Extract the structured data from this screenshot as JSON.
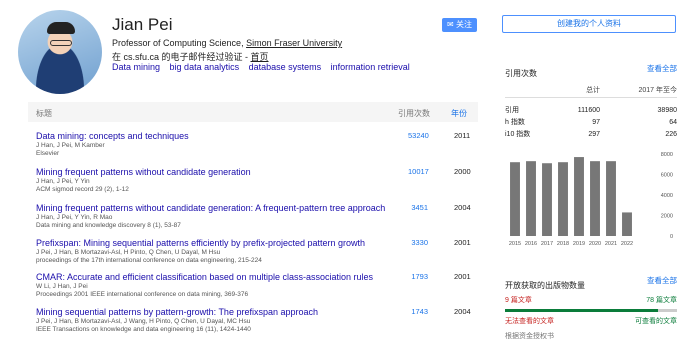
{
  "profile": {
    "name": "Jian Pei",
    "affil_prefix": "Professor of Computing Science, ",
    "affil_org": "Simon Fraser University",
    "verified_prefix": "在 cs.sfu.ca 的电子邮件经过验证 - ",
    "verified_link": "首页",
    "tags": [
      "Data mining",
      "big data analytics",
      "database systems",
      "information retrieval"
    ]
  },
  "buttons": {
    "follow": "关注",
    "create_profile": "创建我的个人资料"
  },
  "table": {
    "col_title": "标题",
    "col_cited": "引用次数",
    "col_year": "年份"
  },
  "articles": [
    {
      "title": "Data mining: concepts and techniques",
      "authors": "J Han, J Pei, M Kamber",
      "venue": "Elsevier",
      "cited": "53240",
      "year": "2011"
    },
    {
      "title": "Mining frequent patterns without candidate generation",
      "authors": "J Han, J Pei, Y Yin",
      "venue": "ACM sigmod record 29 (2), 1-12",
      "cited": "10017",
      "year": "2000"
    },
    {
      "title": "Mining frequent patterns without candidate generation: A frequent-pattern tree approach",
      "authors": "J Han, J Pei, Y Yin, R Mao",
      "venue": "Data mining and knowledge discovery 8 (1), 53-87",
      "cited": "3451",
      "year": "2004"
    },
    {
      "title": "Prefixspan: Mining sequential patterns efficiently by prefix-projected pattern growth",
      "authors": "J Pei, J Han, B Mortazavi-Asl, H Pinto, Q Chen, U Dayal, M Hsu",
      "venue": "proceedings of the 17th international conference on data engineering, 215-224",
      "cited": "3330",
      "year": "2001"
    },
    {
      "title": "CMAR: Accurate and efficient classification based on multiple class-association rules",
      "authors": "W Li, J Han, J Pei",
      "venue": "Proceedings 2001 IEEE international conference on data mining, 369-376",
      "cited": "1793",
      "year": "2001"
    },
    {
      "title": "Mining sequential patterns by pattern-growth: The prefixspan approach",
      "authors": "J Pei, J Han, B Mortazavi-Asl, J Wang, H Pinto, Q Chen, U Dayal, MC Hsu",
      "venue": "IEEE Transactions on knowledge and data engineering 16 (11), 1424-1440",
      "cited": "1743",
      "year": "2004"
    }
  ],
  "citations": {
    "title": "引用次数",
    "view_all": "查看全部",
    "col_all": "总计",
    "col_since": "2017 年至今",
    "rows": [
      {
        "label": "引用",
        "all": "111600",
        "since": "38980"
      },
      {
        "label": "h 指数",
        "all": "97",
        "since": "64"
      },
      {
        "label": "i10 指数",
        "all": "297",
        "since": "226"
      }
    ]
  },
  "chart_data": {
    "type": "bar",
    "categories": [
      "2015",
      "2016",
      "2017",
      "2018",
      "2019",
      "2020",
      "2021",
      "2022"
    ],
    "values": [
      7200,
      7300,
      7100,
      7200,
      7700,
      7300,
      7300,
      2300
    ],
    "ylim": [
      0,
      8000
    ],
    "yticks": [
      "8000",
      "6000",
      "4000",
      "2000",
      "0"
    ],
    "bar_color": "#777777"
  },
  "open_access": {
    "title": "开放获取的出版物数量",
    "view_all": "查看全部",
    "unavailable": "9 篇文章",
    "available": "78 篇文章",
    "unavailable_label": "无法查看的文章",
    "available_label": "可查看的文章",
    "mandate": "根据资金授权书",
    "unavailable_color": "#c5221f",
    "available_color": "#0a7c3a"
  }
}
